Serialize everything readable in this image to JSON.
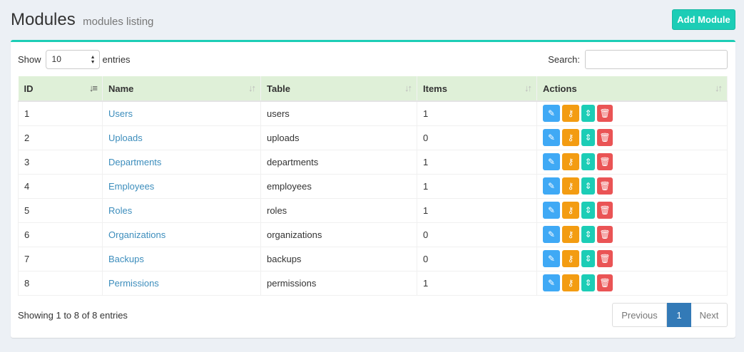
{
  "header": {
    "title": "Modules",
    "subtitle": "modules listing",
    "add_button": "Add Module"
  },
  "controls": {
    "show_label": "Show",
    "entries_value": "10",
    "entries_label": "entries",
    "search_label": "Search:"
  },
  "table": {
    "columns": [
      "ID",
      "Name",
      "Table",
      "Items",
      "Actions"
    ],
    "rows": [
      {
        "id": "1",
        "name": "Users",
        "table": "users",
        "items": "1"
      },
      {
        "id": "2",
        "name": "Uploads",
        "table": "uploads",
        "items": "0"
      },
      {
        "id": "3",
        "name": "Departments",
        "table": "departments",
        "items": "1"
      },
      {
        "id": "4",
        "name": "Employees",
        "table": "employees",
        "items": "1"
      },
      {
        "id": "5",
        "name": "Roles",
        "table": "roles",
        "items": "1"
      },
      {
        "id": "6",
        "name": "Organizations",
        "table": "organizations",
        "items": "0"
      },
      {
        "id": "7",
        "name": "Backups",
        "table": "backups",
        "items": "0"
      },
      {
        "id": "8",
        "name": "Permissions",
        "table": "permissions",
        "items": "1"
      }
    ]
  },
  "footer": {
    "info": "Showing 1 to 8 of 8 entries",
    "previous": "Previous",
    "page": "1",
    "next": "Next"
  },
  "icons": {
    "edit": "edit-icon",
    "key": "key-icon",
    "sort": "sort-icon",
    "delete": "trash-icon"
  },
  "colors": {
    "accent": "#1ccdb6",
    "link": "#3c8dbc",
    "header_row": "#dff0d8",
    "edit": "#3fa9f5",
    "key": "#f39c12",
    "delete": "#ea5455",
    "active_page": "#337ab7"
  }
}
